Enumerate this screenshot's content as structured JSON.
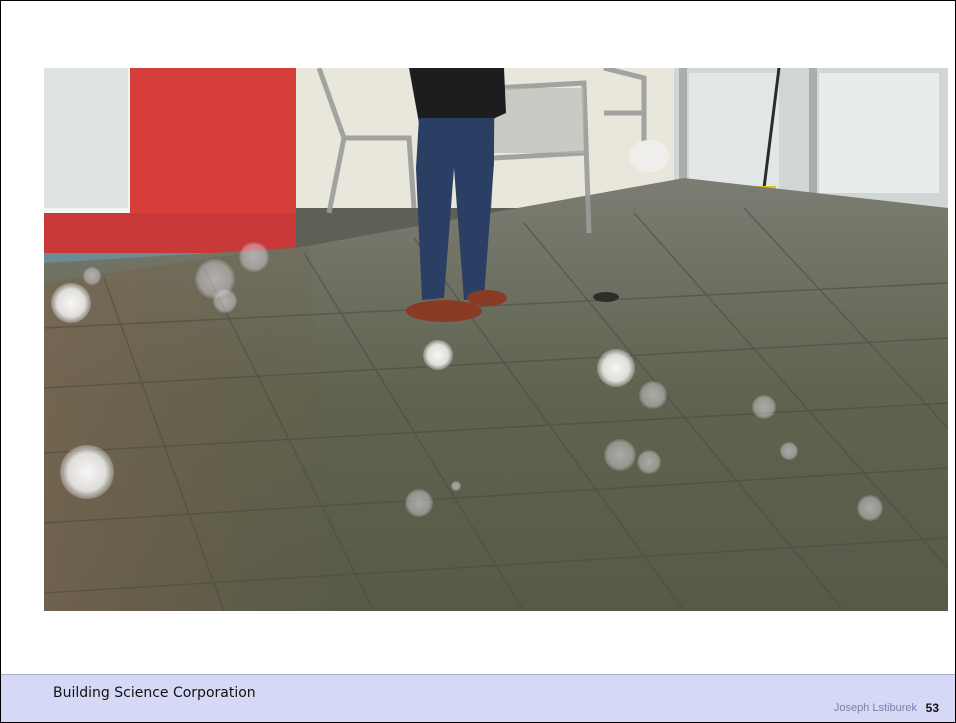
{
  "photo": {
    "subject": "wet-paving-patio-photo"
  },
  "footer": {
    "organization": "Building Science Corporation",
    "author": "Joseph Lstiburek",
    "page_number": "53"
  },
  "colors": {
    "footer_background": "#d6d9f5",
    "page_number": "#111111",
    "author": "#7a7fae"
  }
}
